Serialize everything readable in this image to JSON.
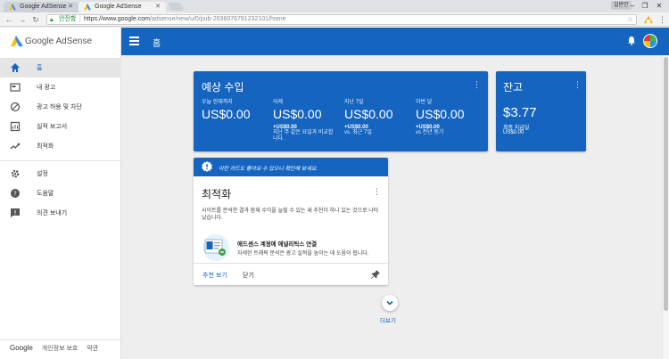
{
  "browser": {
    "tabs": [
      {
        "label": "Google AdSense",
        "active": false
      },
      {
        "label": "Google AdSense",
        "active": true
      }
    ],
    "user_badge": "일반인",
    "security_label": "안전함",
    "url_main": "https://www.google.com",
    "url_path": "/adsense/new/u/0/pub-2036076791232101/home"
  },
  "sidebar": {
    "brand": "Google AdSense",
    "items": [
      {
        "label": "홈",
        "icon": "home-icon"
      },
      {
        "label": "내 광고",
        "icon": "ad-icon"
      },
      {
        "label": "광고 허용 및 차단",
        "icon": "block-icon"
      },
      {
        "label": "실적 보고서",
        "icon": "report-icon"
      },
      {
        "label": "최적화",
        "icon": "trending-icon"
      },
      {
        "label": "설정",
        "icon": "gear-icon"
      },
      {
        "label": "도움말",
        "icon": "help-icon"
      },
      {
        "label": "의견 보내기",
        "icon": "feedback-icon"
      }
    ],
    "footer": {
      "google": "Google",
      "privacy": "개인정보 보호",
      "terms": "약관"
    }
  },
  "header": {
    "title": "홈"
  },
  "earnings": {
    "title": "예상 수입",
    "columns": [
      {
        "label": "오늘 현재까지",
        "value": "US$0.00",
        "compare": "",
        "compare_text": ""
      },
      {
        "label": "어제",
        "value": "US$0.00",
        "compare": "+US$0.00",
        "compare_text": "지난 주 같은 요일과 비교합니다."
      },
      {
        "label": "지난 7일",
        "value": "US$0.00",
        "compare": "+US$0.00",
        "compare_text": "vs. 최근 7일"
      },
      {
        "label": "이번 달",
        "value": "US$0.00",
        "compare": "+US$0.00",
        "compare_text": "vs 전년 동기"
      }
    ]
  },
  "balance": {
    "title": "잔고",
    "value": "$3.77",
    "label": "최종 지급일",
    "sub": "US$0.00"
  },
  "optimization": {
    "banner": "이런 카드도 좋아요 수 있으니 확인해 보세요.",
    "title": "최적화",
    "desc": "사이트를 분석한 결과 잠재 수익을 늘릴 수 있는 새 추천이 하나 있는 것으로 나타났습니다.",
    "rec_title": "애드센스 계정에 애널리틱스 연결",
    "rec_desc": "자세한 트래픽 분석은 광고 실적을 높이는 데 도움이 됩니다.",
    "action_view": "추천 보기",
    "action_close": "닫기"
  },
  "more": {
    "label": "더보기"
  },
  "colors": {
    "primary": "#1565c0",
    "background": "#eeeeee"
  }
}
